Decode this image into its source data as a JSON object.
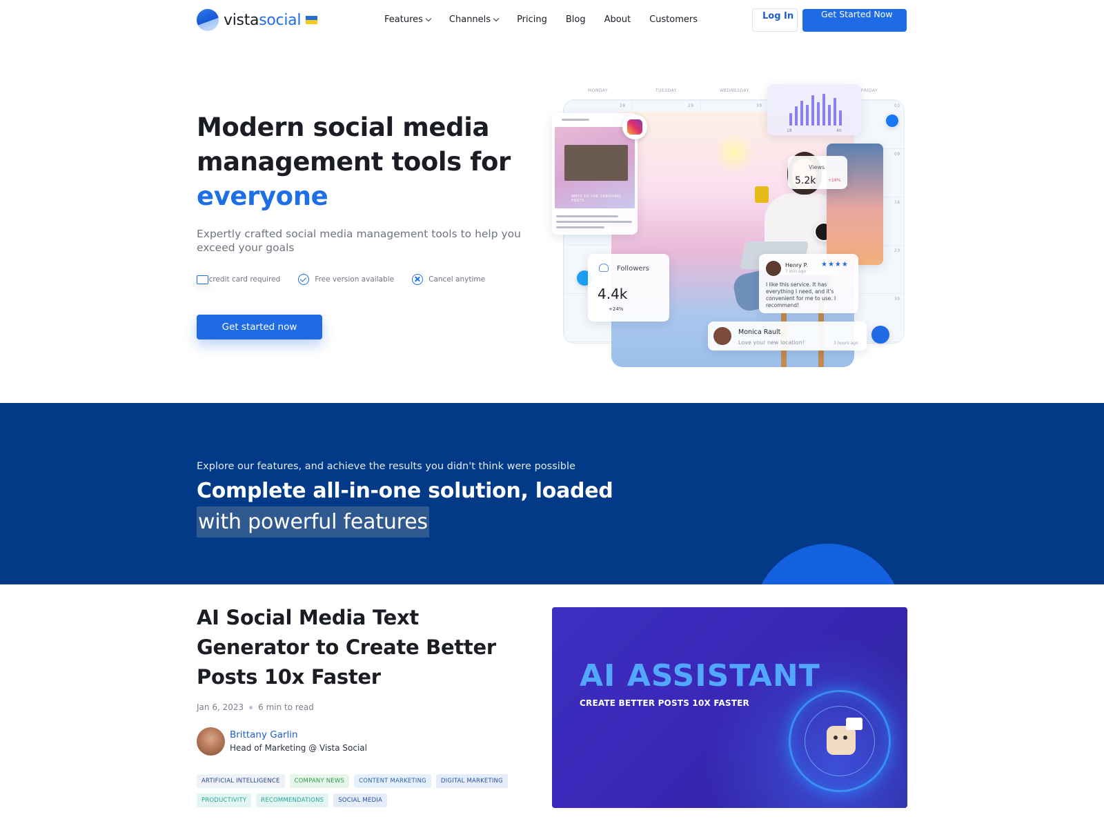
{
  "header": {
    "logo": {
      "part1": "vista",
      "part2": "social"
    },
    "nav": [
      {
        "label": "Features",
        "dropdown": true
      },
      {
        "label": "Channels",
        "dropdown": true
      },
      {
        "label": "Pricing",
        "dropdown": false
      },
      {
        "label": "Blog",
        "dropdown": false
      },
      {
        "label": "About",
        "dropdown": false
      },
      {
        "label": "Customers",
        "dropdown": false
      }
    ],
    "login_label": "Log In",
    "cta_label": "Get Started Now"
  },
  "hero": {
    "title_line1": "Modern social media",
    "title_line2": "management tools for",
    "title_accent": "everyone",
    "subtitle": "Expertly crafted social media management tools to help you exceed your goals",
    "perks": [
      {
        "label": "No credit card required",
        "icon": "credit-card-off-icon"
      },
      {
        "label": "Free version available",
        "icon": "badge-check-icon"
      },
      {
        "label": "Cancel anytime",
        "icon": "circle-x-icon"
      }
    ],
    "cta_label": "Get started now"
  },
  "illustration": {
    "days": [
      "MONDAY",
      "TUESDAY",
      "WEDNESDAY",
      "FRIDAY"
    ],
    "dates": [
      "28",
      "29",
      "30",
      "02",
      "06",
      "09",
      "13",
      "16",
      "23",
      "30"
    ],
    "bars_axis": [
      "18",
      "40"
    ],
    "views": {
      "label": "Views",
      "value": "5.2k",
      "change": "+18%"
    },
    "followers": {
      "label": "Followers",
      "value": "4.4k",
      "change": "+24%"
    },
    "review": {
      "name": "Henry P.",
      "time": "7 min ago",
      "stars": "★★★★",
      "text": "I like this service. It has everything I need, and it's convenient for me to use. I recommend!"
    },
    "comment": {
      "name": "Monica Rault",
      "text": "Love your new location!",
      "time": "3 hours ago"
    },
    "post_caption": "WAYS TO USE CAROUSEL POSTS"
  },
  "features_band": {
    "kicker": "Explore our features, and achieve the results you didn't think were possible",
    "title_line1": "Complete all-in-one solution, loaded",
    "title_line2": "with powerful features"
  },
  "article": {
    "title": "AI Social Media Text Generator to Create Better Posts 10x Faster",
    "date": "Jan 6, 2023",
    "read_time": "6 min to read",
    "author_name": "Brittany Garlin",
    "author_role": "Head of Marketing @ Vista Social",
    "tags": [
      {
        "label": "ARTIFICIAL INTELLIGENCE",
        "bg": "#eef2f8",
        "fg": "#2a4a8a"
      },
      {
        "label": "COMPANY NEWS",
        "bg": "#e6f6ea",
        "fg": "#2e9a48"
      },
      {
        "label": "CONTENT MARKETING",
        "bg": "#e5f0fb",
        "fg": "#2a5ea8"
      },
      {
        "label": "DIGITAL MARKETING",
        "bg": "#e5ecfa",
        "fg": "#2a4fa8"
      },
      {
        "label": "PRODUCTIVITY",
        "bg": "#e3f6f4",
        "fg": "#27a496"
      },
      {
        "label": "RECOMMENDATIONS",
        "bg": "#e3f6f4",
        "fg": "#27a496"
      },
      {
        "label": "SOCIAL MEDIA",
        "bg": "#e5ecfa",
        "fg": "#2a4fa8"
      }
    ],
    "image": {
      "title": "AI ASSISTANT",
      "subtitle": "CREATE BETTER POSTS 10X FASTER"
    }
  }
}
